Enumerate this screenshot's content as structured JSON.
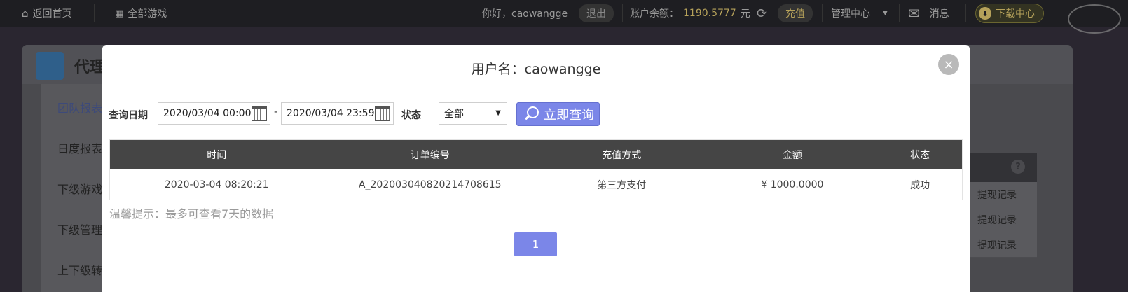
{
  "topbar": {
    "home_label": "返回首页",
    "all_games_label": "全部游戏",
    "greeting": "你好，caowangge",
    "logout_label": "退出",
    "balance_label": "账户余额：",
    "balance_value": "1190.5777",
    "balance_unit": "元",
    "recharge_label": "充值",
    "manage_label": "管理中心",
    "messages_label": "消息",
    "download_label": "下载中心"
  },
  "background": {
    "panel_title": "代理",
    "sidebar_items": [
      "团队报表",
      "日度报表",
      "下级游戏",
      "下级管理",
      "上下级转"
    ],
    "right_rows": [
      "提现记录",
      "提现记录",
      "提现记录"
    ]
  },
  "modal": {
    "title": "用户名：caowangge",
    "close_symbol": "×",
    "filter": {
      "date_label": "查询日期",
      "start_date": "2020/03/04 00:00",
      "separator": "-",
      "end_date": "2020/03/04 23:59",
      "status_label": "状态",
      "status_value": "全部",
      "query_label": "立即查询"
    },
    "table": {
      "headers": [
        "时间",
        "订单编号",
        "充值方式",
        "金额",
        "状态"
      ],
      "rows": [
        [
          "2020-03-04 08:20:21",
          "A_202003040820214708615",
          "第三方支付",
          "¥ 1000.0000",
          "成功"
        ]
      ]
    },
    "tip": "温馨提示：最多可查看7天的数据",
    "pagination": {
      "current_page": "1"
    }
  },
  "colors": {
    "accent": "#7b86e8",
    "topbar_bg": "#1e1e22",
    "table_header_bg": "#454545",
    "gold": "#b5a15a"
  },
  "icons": [
    "home-icon",
    "grid-icon",
    "refresh-icon",
    "dropdown-caret-icon",
    "mail-icon",
    "download-icon",
    "calendar-icon",
    "search-icon",
    "close-icon"
  ]
}
